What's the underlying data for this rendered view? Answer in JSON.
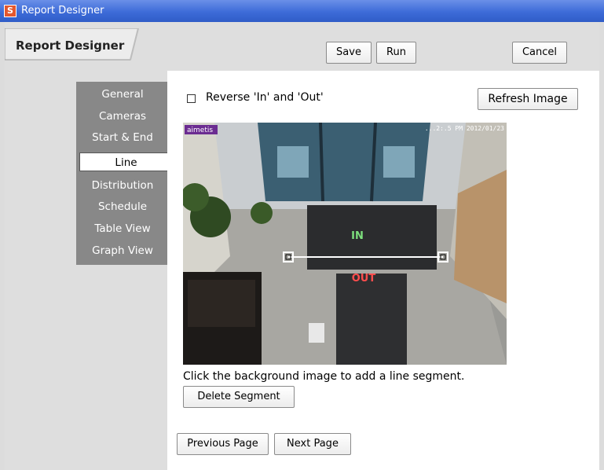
{
  "window": {
    "title": "Report Designer",
    "app_icon": "S"
  },
  "header": {
    "tab_label": "Report Designer"
  },
  "toolbar": {
    "save_label": "Save",
    "run_label": "Run",
    "cancel_label": "Cancel"
  },
  "nav": {
    "items": [
      {
        "label": "General"
      },
      {
        "label": "Cameras"
      },
      {
        "label": "Start & End"
      },
      {
        "label": "Line"
      },
      {
        "label": "Distribution"
      },
      {
        "label": "Schedule"
      },
      {
        "label": "Table View"
      },
      {
        "label": "Graph View"
      }
    ],
    "active": "Line"
  },
  "line_page": {
    "reverse_label": "Reverse 'In' and 'Out'",
    "reverse_checked": false,
    "refresh_label": "Refresh Image",
    "camera": {
      "logo": "aimetis",
      "timestamp": "...2:.5 PM 2012/01/23",
      "in_label": "IN",
      "out_label": "OUT"
    },
    "hint": "Click the background image to add a line segment.",
    "delete_label": "Delete Segment",
    "previous_label": "Previous Page",
    "next_label": "Next Page"
  },
  "colors": {
    "titlebar": "#3d6bd8",
    "nav_bg": "#888888",
    "in_color": "#7de07d",
    "out_color": "#ff4d4d",
    "logo_color": "#8a2be2"
  }
}
